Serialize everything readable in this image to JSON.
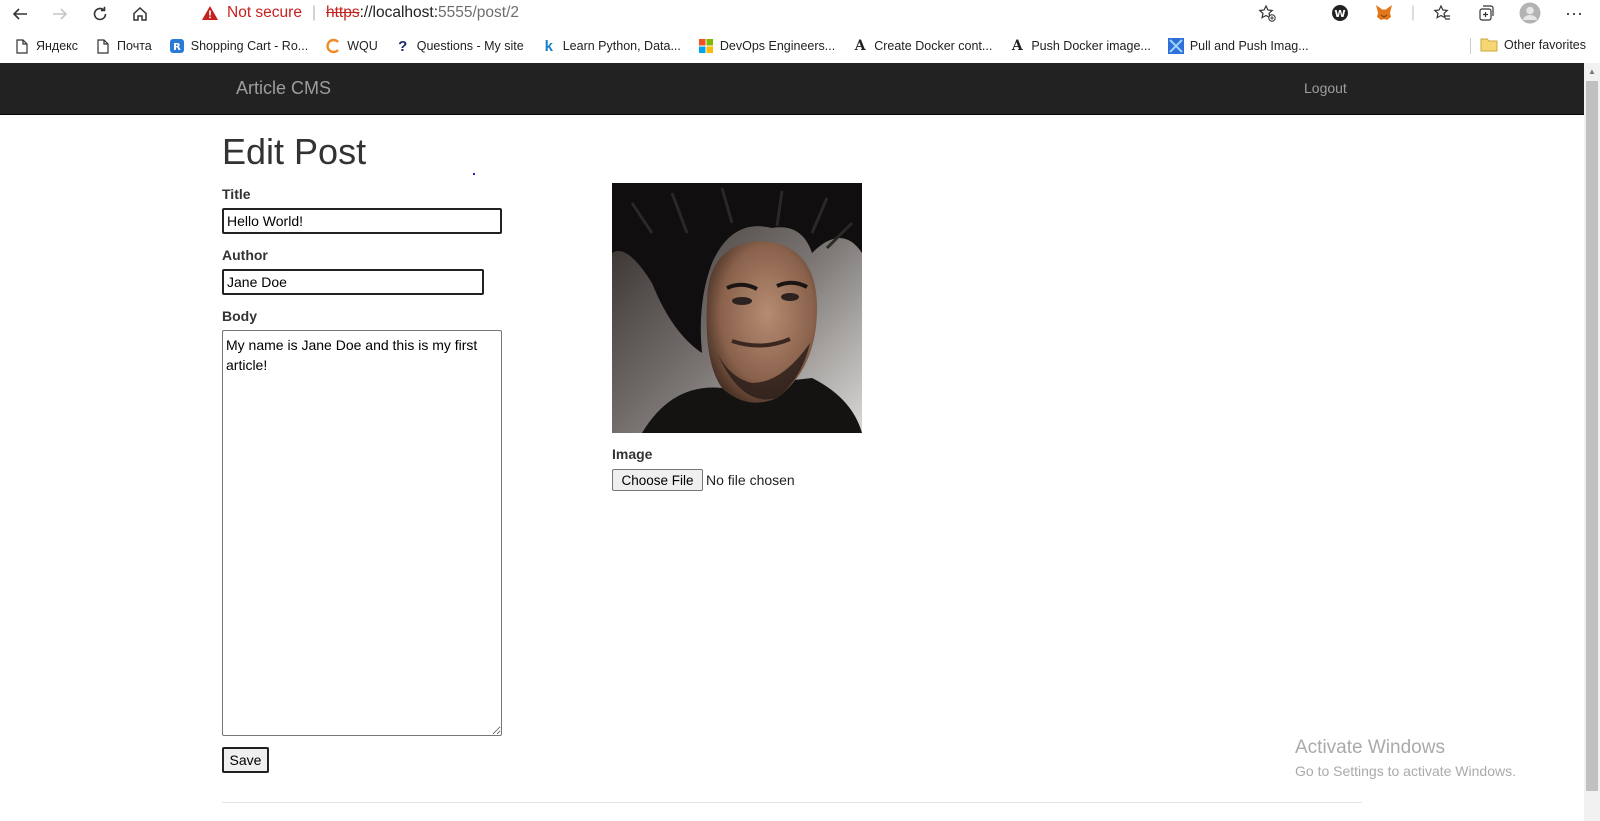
{
  "browser": {
    "security_label": "Not secure",
    "url_scheme": "https",
    "url_host": "://localhost:",
    "url_port_path": "5555/post/2",
    "bookmarks": [
      {
        "label": "Яндекс",
        "icon": "page-icon"
      },
      {
        "label": "Почта",
        "icon": "page-icon"
      },
      {
        "label": "Shopping Cart - Ro...",
        "icon": "cart-logo-icon"
      },
      {
        "label": "WQU",
        "icon": "wqu-logo-icon"
      },
      {
        "label": "Questions - My site",
        "icon": "question-icon"
      },
      {
        "label": "Learn Python, Data...",
        "icon": "k-logo-icon"
      },
      {
        "label": "DevOps Engineers...",
        "icon": "microsoft-logo-icon"
      },
      {
        "label": "Create Docker cont...",
        "icon": "a-logo-icon"
      },
      {
        "label": "Push Docker image...",
        "icon": "a-logo-icon"
      },
      {
        "label": "Pull and Push Imag...",
        "icon": "azure-logo-icon"
      }
    ],
    "other_favorites": "Other favorites"
  },
  "navbar": {
    "brand": "Article CMS",
    "logout": "Logout"
  },
  "form": {
    "page_title": "Edit Post",
    "title_label": "Title",
    "title_value": "Hello World!",
    "author_label": "Author",
    "author_value": "Jane Doe",
    "body_label": "Body",
    "body_value": "My name is Jane Doe and this is my first article!",
    "image_label": "Image",
    "choose_file": "Choose File",
    "no_file": "No file chosen",
    "save_label": "Save"
  },
  "watermark": {
    "line1": "Activate Windows",
    "line2": "Go to Settings to activate Windows."
  }
}
